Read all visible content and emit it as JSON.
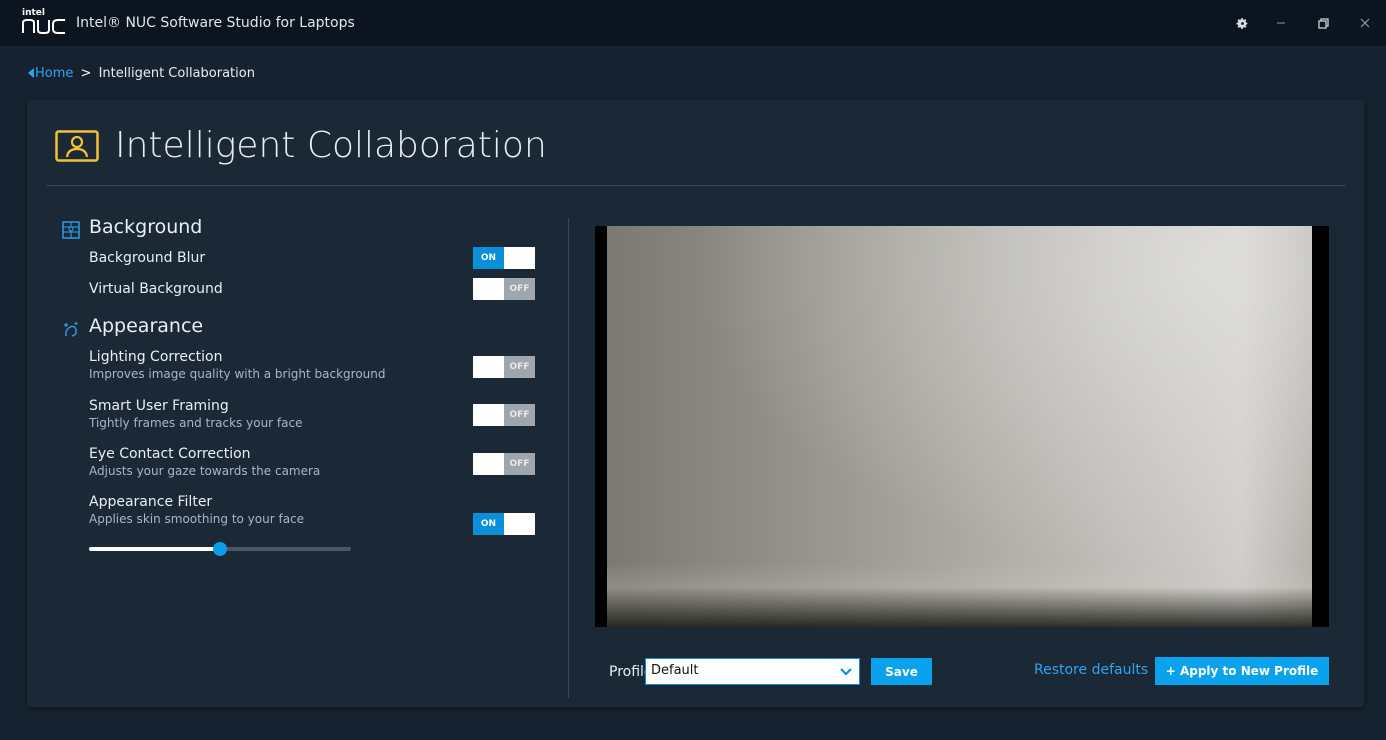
{
  "titlebar": {
    "logo_small": "intel",
    "logo_big": "NUC",
    "title": "Intel® NUC Software Studio for Laptops",
    "icons": [
      "gear-icon",
      "minimize-icon",
      "restore-icon",
      "close-icon"
    ]
  },
  "breadcrumb": {
    "home": "Home",
    "separator": ">",
    "current": "Intelligent Collaboration"
  },
  "page": {
    "title": "Intelligent Collaboration",
    "icon": "user-frame-icon"
  },
  "sections": {
    "background": {
      "label": "Background",
      "icon": "background-grid-icon",
      "items": [
        {
          "title": "Background Blur",
          "state": "ON"
        },
        {
          "title": "Virtual Background",
          "state": "OFF"
        }
      ]
    },
    "appearance": {
      "label": "Appearance",
      "icon": "sparkle-face-icon",
      "items": [
        {
          "title": "Lighting Correction",
          "desc": "Improves image quality with a bright background",
          "state": "OFF"
        },
        {
          "title": "Smart User Framing",
          "desc": "Tightly frames and tracks your face",
          "state": "OFF"
        },
        {
          "title": "Eye Contact Correction",
          "desc": "Adjusts your gaze towards the camera",
          "state": "OFF"
        },
        {
          "title": "Appearance Filter",
          "desc": "Applies skin smoothing to your face",
          "state": "ON"
        }
      ],
      "filter_level": 0.5
    }
  },
  "footer": {
    "profile_label": "Profile",
    "profile_value": "Default",
    "save": "Save",
    "restore": "Restore defaults",
    "apply": "+ Apply to New Profile"
  },
  "colors": {
    "accent": "#0a8fd9",
    "link": "#2ea3f2",
    "icon_gold": "#f2c233"
  }
}
